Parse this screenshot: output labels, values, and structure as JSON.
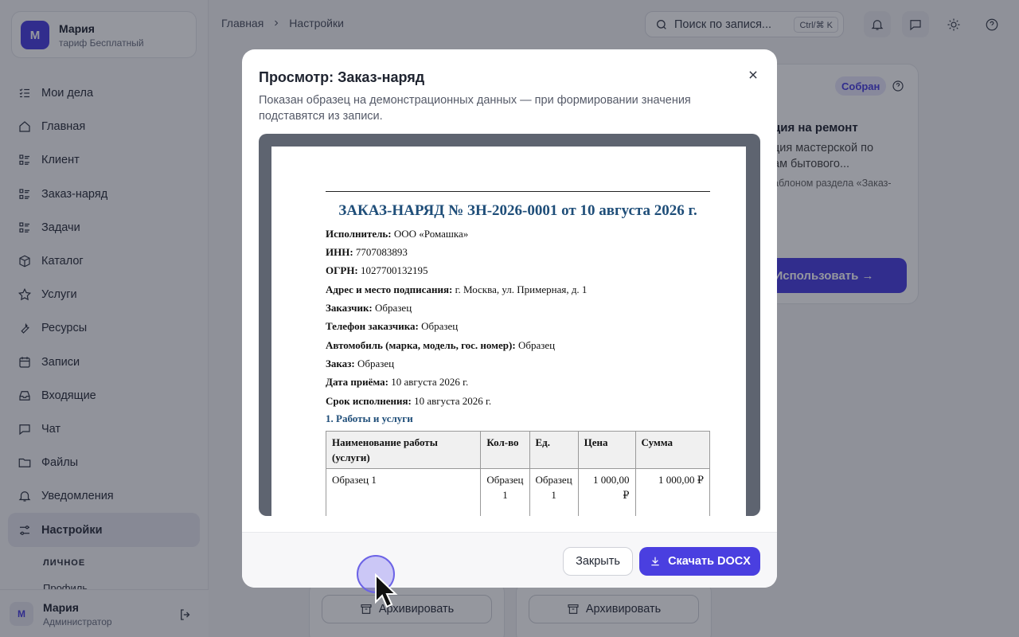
{
  "account": {
    "initial": "М",
    "name": "Мария",
    "plan": "тариф Бесплатный"
  },
  "nav": [
    {
      "label": "Мои дела",
      "icon": "checklist-icon"
    },
    {
      "label": "Главная",
      "icon": "home-icon"
    },
    {
      "label": "Клиент",
      "icon": "list-icon"
    },
    {
      "label": "Заказ-наряд",
      "icon": "list-icon"
    },
    {
      "label": "Задачи",
      "icon": "list-icon"
    },
    {
      "label": "Каталог",
      "icon": "box-icon"
    },
    {
      "label": "Услуги",
      "icon": "star-icon"
    },
    {
      "label": "Ресурсы",
      "icon": "wrench-icon"
    },
    {
      "label": "Записи",
      "icon": "calendar-icon"
    },
    {
      "label": "Входящие",
      "icon": "inbox-icon"
    },
    {
      "label": "Чат",
      "icon": "chat-icon"
    },
    {
      "label": "Файлы",
      "icon": "folder-icon"
    },
    {
      "label": "Уведомления",
      "icon": "bell-icon"
    },
    {
      "label": "Настройки",
      "icon": "sliders-icon",
      "active": true
    }
  ],
  "nav_section": "ЛИЧНОЕ",
  "nav_sub": "Профиль",
  "footer_user": {
    "initial": "М",
    "name": "Мария",
    "role": "Администратор"
  },
  "breadcrumb": {
    "home": "Главная",
    "current": "Настройки"
  },
  "search": {
    "placeholder": "Поиск по записям…",
    "value": "Поиск по запися...",
    "shortcut": "Ctrl/⌘ K"
  },
  "bg": {
    "badge": "Собран",
    "card_title": "ция на ремонт",
    "card_desc1": "ция мастерской по",
    "card_desc2": "ам бытового...",
    "card_note": "аблоном раздела «Заказ-",
    "use_button": "Использовать →",
    "archive1": "Архивировать",
    "archive2": "Архивировать"
  },
  "modal": {
    "title": "Просмотр: Заказ-наряд",
    "description": "Показан образец на демонстрационных данных — при формировании значения подставятся из записи.",
    "close_label": "Закрыть",
    "download_label": "Скачать DOCX"
  },
  "document": {
    "title": "ЗАКАЗ-НАРЯД № ЗН-2026-0001 от 10 августа 2026 г.",
    "fields": [
      {
        "label": "Исполнитель:",
        "value": "ООО «Ромашка»"
      },
      {
        "label": "ИНН:",
        "value": "7707083893"
      },
      {
        "label": "ОГРН:",
        "value": "1027700132195"
      },
      {
        "label": "Адрес и место подписания:",
        "value": "г. Москва, ул. Примерная, д. 1"
      },
      {
        "label": "Заказчик:",
        "value": "Образец"
      },
      {
        "label": "Телефон заказчика:",
        "value": "Образец"
      },
      {
        "label": "Автомобиль (марка, модель, гос. номер):",
        "value": "Образец"
      },
      {
        "label": "Заказ:",
        "value": "Образец"
      },
      {
        "label": "Дата приёма:",
        "value": "10 августа 2026 г."
      },
      {
        "label": "Срок исполнения:",
        "value": "10 августа 2026 г."
      }
    ],
    "section1": "1. Работы и услуги",
    "table": {
      "headers": [
        "Наименование работы (услуги)",
        "Кол-во",
        "Ед.",
        "Цена",
        "Сумма"
      ],
      "rows": [
        [
          "Образец 1",
          "Образец 1",
          "Образец 1",
          "1 000,00 ₽",
          "1 000,00 ₽"
        ]
      ]
    }
  }
}
